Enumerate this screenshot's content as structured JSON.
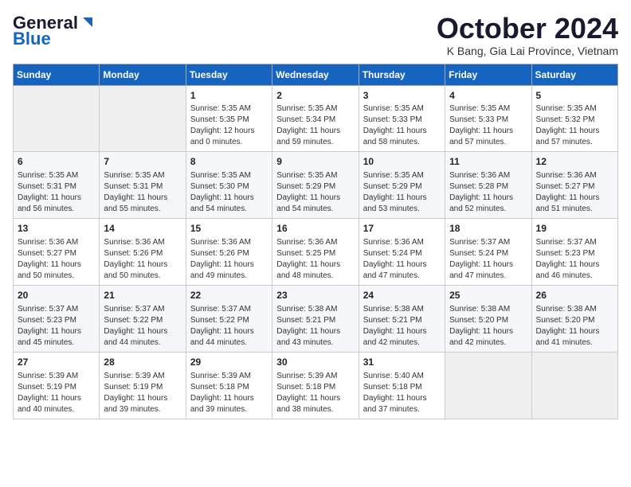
{
  "header": {
    "logo_general": "General",
    "logo_blue": "Blue",
    "month_title": "October 2024",
    "location": "K Bang, Gia Lai Province, Vietnam"
  },
  "calendar": {
    "days_of_week": [
      "Sunday",
      "Monday",
      "Tuesday",
      "Wednesday",
      "Thursday",
      "Friday",
      "Saturday"
    ],
    "weeks": [
      [
        {
          "day": "",
          "info": ""
        },
        {
          "day": "",
          "info": ""
        },
        {
          "day": "1",
          "info": "Sunrise: 5:35 AM\nSunset: 5:35 PM\nDaylight: 12 hours\nand 0 minutes."
        },
        {
          "day": "2",
          "info": "Sunrise: 5:35 AM\nSunset: 5:34 PM\nDaylight: 11 hours\nand 59 minutes."
        },
        {
          "day": "3",
          "info": "Sunrise: 5:35 AM\nSunset: 5:33 PM\nDaylight: 11 hours\nand 58 minutes."
        },
        {
          "day": "4",
          "info": "Sunrise: 5:35 AM\nSunset: 5:33 PM\nDaylight: 11 hours\nand 57 minutes."
        },
        {
          "day": "5",
          "info": "Sunrise: 5:35 AM\nSunset: 5:32 PM\nDaylight: 11 hours\nand 57 minutes."
        }
      ],
      [
        {
          "day": "6",
          "info": "Sunrise: 5:35 AM\nSunset: 5:31 PM\nDaylight: 11 hours\nand 56 minutes."
        },
        {
          "day": "7",
          "info": "Sunrise: 5:35 AM\nSunset: 5:31 PM\nDaylight: 11 hours\nand 55 minutes."
        },
        {
          "day": "8",
          "info": "Sunrise: 5:35 AM\nSunset: 5:30 PM\nDaylight: 11 hours\nand 54 minutes."
        },
        {
          "day": "9",
          "info": "Sunrise: 5:35 AM\nSunset: 5:29 PM\nDaylight: 11 hours\nand 54 minutes."
        },
        {
          "day": "10",
          "info": "Sunrise: 5:35 AM\nSunset: 5:29 PM\nDaylight: 11 hours\nand 53 minutes."
        },
        {
          "day": "11",
          "info": "Sunrise: 5:36 AM\nSunset: 5:28 PM\nDaylight: 11 hours\nand 52 minutes."
        },
        {
          "day": "12",
          "info": "Sunrise: 5:36 AM\nSunset: 5:27 PM\nDaylight: 11 hours\nand 51 minutes."
        }
      ],
      [
        {
          "day": "13",
          "info": "Sunrise: 5:36 AM\nSunset: 5:27 PM\nDaylight: 11 hours\nand 50 minutes."
        },
        {
          "day": "14",
          "info": "Sunrise: 5:36 AM\nSunset: 5:26 PM\nDaylight: 11 hours\nand 50 minutes."
        },
        {
          "day": "15",
          "info": "Sunrise: 5:36 AM\nSunset: 5:26 PM\nDaylight: 11 hours\nand 49 minutes."
        },
        {
          "day": "16",
          "info": "Sunrise: 5:36 AM\nSunset: 5:25 PM\nDaylight: 11 hours\nand 48 minutes."
        },
        {
          "day": "17",
          "info": "Sunrise: 5:36 AM\nSunset: 5:24 PM\nDaylight: 11 hours\nand 47 minutes."
        },
        {
          "day": "18",
          "info": "Sunrise: 5:37 AM\nSunset: 5:24 PM\nDaylight: 11 hours\nand 47 minutes."
        },
        {
          "day": "19",
          "info": "Sunrise: 5:37 AM\nSunset: 5:23 PM\nDaylight: 11 hours\nand 46 minutes."
        }
      ],
      [
        {
          "day": "20",
          "info": "Sunrise: 5:37 AM\nSunset: 5:23 PM\nDaylight: 11 hours\nand 45 minutes."
        },
        {
          "day": "21",
          "info": "Sunrise: 5:37 AM\nSunset: 5:22 PM\nDaylight: 11 hours\nand 44 minutes."
        },
        {
          "day": "22",
          "info": "Sunrise: 5:37 AM\nSunset: 5:22 PM\nDaylight: 11 hours\nand 44 minutes."
        },
        {
          "day": "23",
          "info": "Sunrise: 5:38 AM\nSunset: 5:21 PM\nDaylight: 11 hours\nand 43 minutes."
        },
        {
          "day": "24",
          "info": "Sunrise: 5:38 AM\nSunset: 5:21 PM\nDaylight: 11 hours\nand 42 minutes."
        },
        {
          "day": "25",
          "info": "Sunrise: 5:38 AM\nSunset: 5:20 PM\nDaylight: 11 hours\nand 42 minutes."
        },
        {
          "day": "26",
          "info": "Sunrise: 5:38 AM\nSunset: 5:20 PM\nDaylight: 11 hours\nand 41 minutes."
        }
      ],
      [
        {
          "day": "27",
          "info": "Sunrise: 5:39 AM\nSunset: 5:19 PM\nDaylight: 11 hours\nand 40 minutes."
        },
        {
          "day": "28",
          "info": "Sunrise: 5:39 AM\nSunset: 5:19 PM\nDaylight: 11 hours\nand 39 minutes."
        },
        {
          "day": "29",
          "info": "Sunrise: 5:39 AM\nSunset: 5:18 PM\nDaylight: 11 hours\nand 39 minutes."
        },
        {
          "day": "30",
          "info": "Sunrise: 5:39 AM\nSunset: 5:18 PM\nDaylight: 11 hours\nand 38 minutes."
        },
        {
          "day": "31",
          "info": "Sunrise: 5:40 AM\nSunset: 5:18 PM\nDaylight: 11 hours\nand 37 minutes."
        },
        {
          "day": "",
          "info": ""
        },
        {
          "day": "",
          "info": ""
        }
      ]
    ]
  }
}
